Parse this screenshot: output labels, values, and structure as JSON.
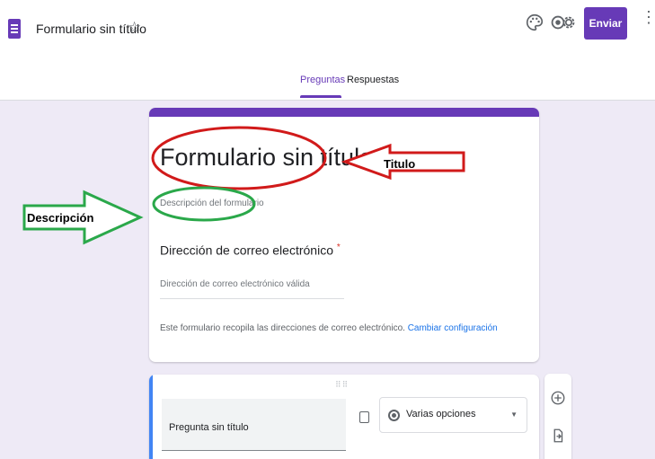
{
  "app": {
    "doc_title": "Formulario sin título",
    "send_label": "Enviar"
  },
  "icons": {
    "app": "google-forms-icon",
    "star": "star-outline-icon",
    "palette": "palette-icon",
    "preview": "eye-icon",
    "settings": "gear-icon",
    "more": "more-vert-icon",
    "image": "image-icon",
    "add": "add-circle-icon",
    "import": "import-questions-icon"
  },
  "tabs": [
    {
      "label": "Preguntas",
      "active": true
    },
    {
      "label": "Respuestas",
      "active": false
    }
  ],
  "form": {
    "title": "Formulario sin título",
    "description_placeholder": "Descripción del formulario",
    "email_question": "Dirección de correo electrónico",
    "required_mark": "*",
    "email_placeholder": "Dirección de correo electrónico válida",
    "collect_note": "Este formulario recopila las direcciones de correo electrónico.",
    "change_settings_link": "Cambiar configuración"
  },
  "question": {
    "title": "Pregunta sin título",
    "type": "Varias opciones"
  },
  "annotations": {
    "title_label": "Titulo",
    "description_label": "Descripción",
    "title_color": "#d11a1a",
    "description_color": "#2aa84a"
  },
  "colors": {
    "brand": "#673ab7",
    "canvas": "#eeeaf6",
    "link": "#1a73e8",
    "active_bar": "#4285f4"
  }
}
